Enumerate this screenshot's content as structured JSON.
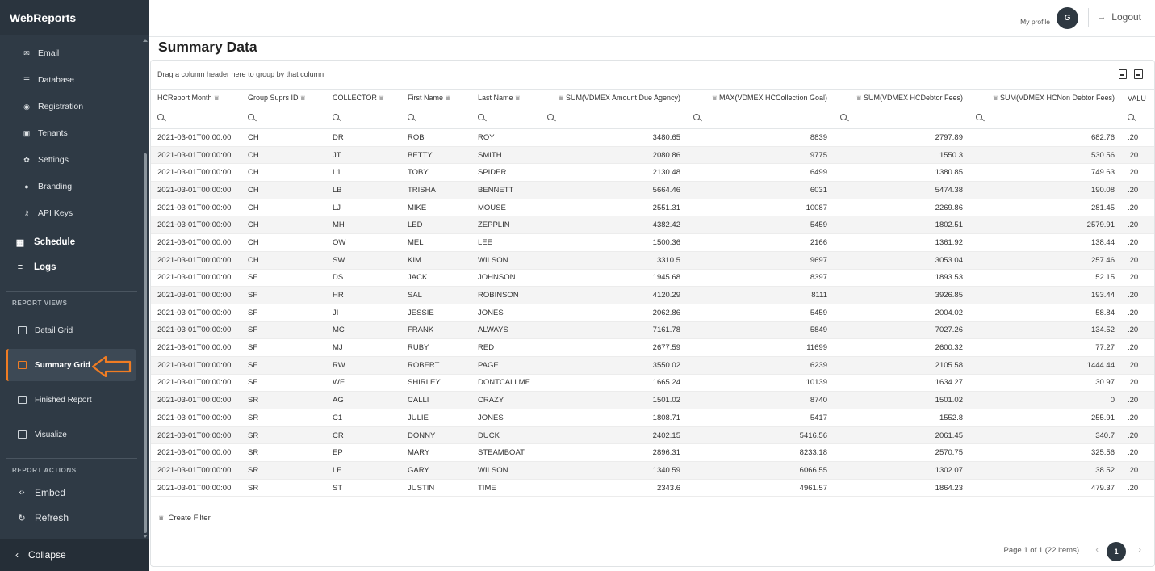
{
  "app": {
    "brand": "WebReports"
  },
  "sidebar": {
    "sub_items": [
      {
        "label": "Email",
        "icon": "mail-icon"
      },
      {
        "label": "Database",
        "icon": "database-icon"
      },
      {
        "label": "Registration",
        "icon": "globe-icon"
      },
      {
        "label": "Tenants",
        "icon": "tenant-icon"
      },
      {
        "label": "Settings",
        "icon": "gear-icon"
      },
      {
        "label": "Branding",
        "icon": "palette-icon"
      },
      {
        "label": "API Keys",
        "icon": "key-icon"
      }
    ],
    "main_items": [
      {
        "label": "Schedule",
        "icon": "calendar-icon"
      },
      {
        "label": "Logs",
        "icon": "list-icon"
      }
    ],
    "report_views_label": "REPORT VIEWS",
    "report_views": [
      {
        "label": "Detail Grid"
      },
      {
        "label": "Summary Grid",
        "active": true
      },
      {
        "label": "Finished Report"
      },
      {
        "label": "Visualize"
      }
    ],
    "report_actions_label": "REPORT ACTIONS",
    "report_actions": [
      {
        "label": "Embed",
        "icon": "code-icon"
      },
      {
        "label": "Refresh",
        "icon": "refresh-icon"
      }
    ],
    "collapse_label": "Collapse",
    "accent_color": "#f07c23"
  },
  "header": {
    "my_profile": "My profile",
    "avatar_initial": "G",
    "logout": "Logout"
  },
  "page": {
    "title": "Summary Data"
  },
  "grid": {
    "group_panel_text": "Drag a column header here to group by that column",
    "columns": [
      "HCReport Month",
      "Group Suprs ID",
      "COLLECTOR",
      "First Name",
      "Last Name",
      "SUM(VDMEX Amount Due Agency)",
      "MAX(VDMEX HCCollection Goal)",
      "SUM(VDMEX HCDebtor Fees)",
      "SUM(VDMEX HCNon Debtor Fees)",
      "VALU"
    ],
    "rows": [
      [
        "2021-03-01T00:00:00",
        "CH",
        "DR",
        "ROB",
        "ROY",
        "3480.65",
        "8839",
        "2797.89",
        "682.76",
        ".20"
      ],
      [
        "2021-03-01T00:00:00",
        "CH",
        "JT",
        "BETTY",
        "SMITH",
        "2080.86",
        "9775",
        "1550.3",
        "530.56",
        ".20"
      ],
      [
        "2021-03-01T00:00:00",
        "CH",
        "L1",
        "TOBY",
        "SPIDER",
        "2130.48",
        "6499",
        "1380.85",
        "749.63",
        ".20"
      ],
      [
        "2021-03-01T00:00:00",
        "CH",
        "LB",
        "TRISHA",
        "BENNETT",
        "5664.46",
        "6031",
        "5474.38",
        "190.08",
        ".20"
      ],
      [
        "2021-03-01T00:00:00",
        "CH",
        "LJ",
        "MIKE",
        "MOUSE",
        "2551.31",
        "10087",
        "2269.86",
        "281.45",
        ".20"
      ],
      [
        "2021-03-01T00:00:00",
        "CH",
        "MH",
        "LED",
        "ZEPPLIN",
        "4382.42",
        "5459",
        "1802.51",
        "2579.91",
        ".20"
      ],
      [
        "2021-03-01T00:00:00",
        "CH",
        "OW",
        "MEL",
        "LEE",
        "1500.36",
        "2166",
        "1361.92",
        "138.44",
        ".20"
      ],
      [
        "2021-03-01T00:00:00",
        "CH",
        "SW",
        "KIM",
        "WILSON",
        "3310.5",
        "9697",
        "3053.04",
        "257.46",
        ".20"
      ],
      [
        "2021-03-01T00:00:00",
        "SF",
        "DS",
        "JACK",
        "JOHNSON",
        "1945.68",
        "8397",
        "1893.53",
        "52.15",
        ".20"
      ],
      [
        "2021-03-01T00:00:00",
        "SF",
        "HR",
        "SAL",
        "ROBINSON",
        "4120.29",
        "8111",
        "3926.85",
        "193.44",
        ".20"
      ],
      [
        "2021-03-01T00:00:00",
        "SF",
        "JI",
        "JESSIE",
        "JONES",
        "2062.86",
        "5459",
        "2004.02",
        "58.84",
        ".20"
      ],
      [
        "2021-03-01T00:00:00",
        "SF",
        "MC",
        "FRANK",
        "ALWAYS",
        "7161.78",
        "5849",
        "7027.26",
        "134.52",
        ".20"
      ],
      [
        "2021-03-01T00:00:00",
        "SF",
        "MJ",
        "RUBY",
        "RED",
        "2677.59",
        "11699",
        "2600.32",
        "77.27",
        ".20"
      ],
      [
        "2021-03-01T00:00:00",
        "SF",
        "RW",
        "ROBERT",
        "PAGE",
        "3550.02",
        "6239",
        "2105.58",
        "1444.44",
        ".20"
      ],
      [
        "2021-03-01T00:00:00",
        "SF",
        "WF",
        "SHIRLEY",
        "DONTCALLME",
        "1665.24",
        "10139",
        "1634.27",
        "30.97",
        ".20"
      ],
      [
        "2021-03-01T00:00:00",
        "SR",
        "AG",
        "CALLI",
        "CRAZY",
        "1501.02",
        "8740",
        "1501.02",
        "0",
        ".20"
      ],
      [
        "2021-03-01T00:00:00",
        "SR",
        "C1",
        "JULIE",
        "JONES",
        "1808.71",
        "5417",
        "1552.8",
        "255.91",
        ".20"
      ],
      [
        "2021-03-01T00:00:00",
        "SR",
        "CR",
        "DONNY",
        "DUCK",
        "2402.15",
        "5416.56",
        "2061.45",
        "340.7",
        ".20"
      ],
      [
        "2021-03-01T00:00:00",
        "SR",
        "EP",
        "MARY",
        "STEAMBOAT",
        "2896.31",
        "8233.18",
        "2570.75",
        "325.56",
        ".20"
      ],
      [
        "2021-03-01T00:00:00",
        "SR",
        "LF",
        "GARY",
        "WILSON",
        "1340.59",
        "6066.55",
        "1302.07",
        "38.52",
        ".20"
      ],
      [
        "2021-03-01T00:00:00",
        "SR",
        "ST",
        "JUSTIN",
        "TIME",
        "2343.6",
        "4961.57",
        "1864.23",
        "479.37",
        ".20"
      ]
    ],
    "create_filter": "Create Filter",
    "pager_info": "Page 1 of 1 (22 items)",
    "current_page": "1"
  }
}
